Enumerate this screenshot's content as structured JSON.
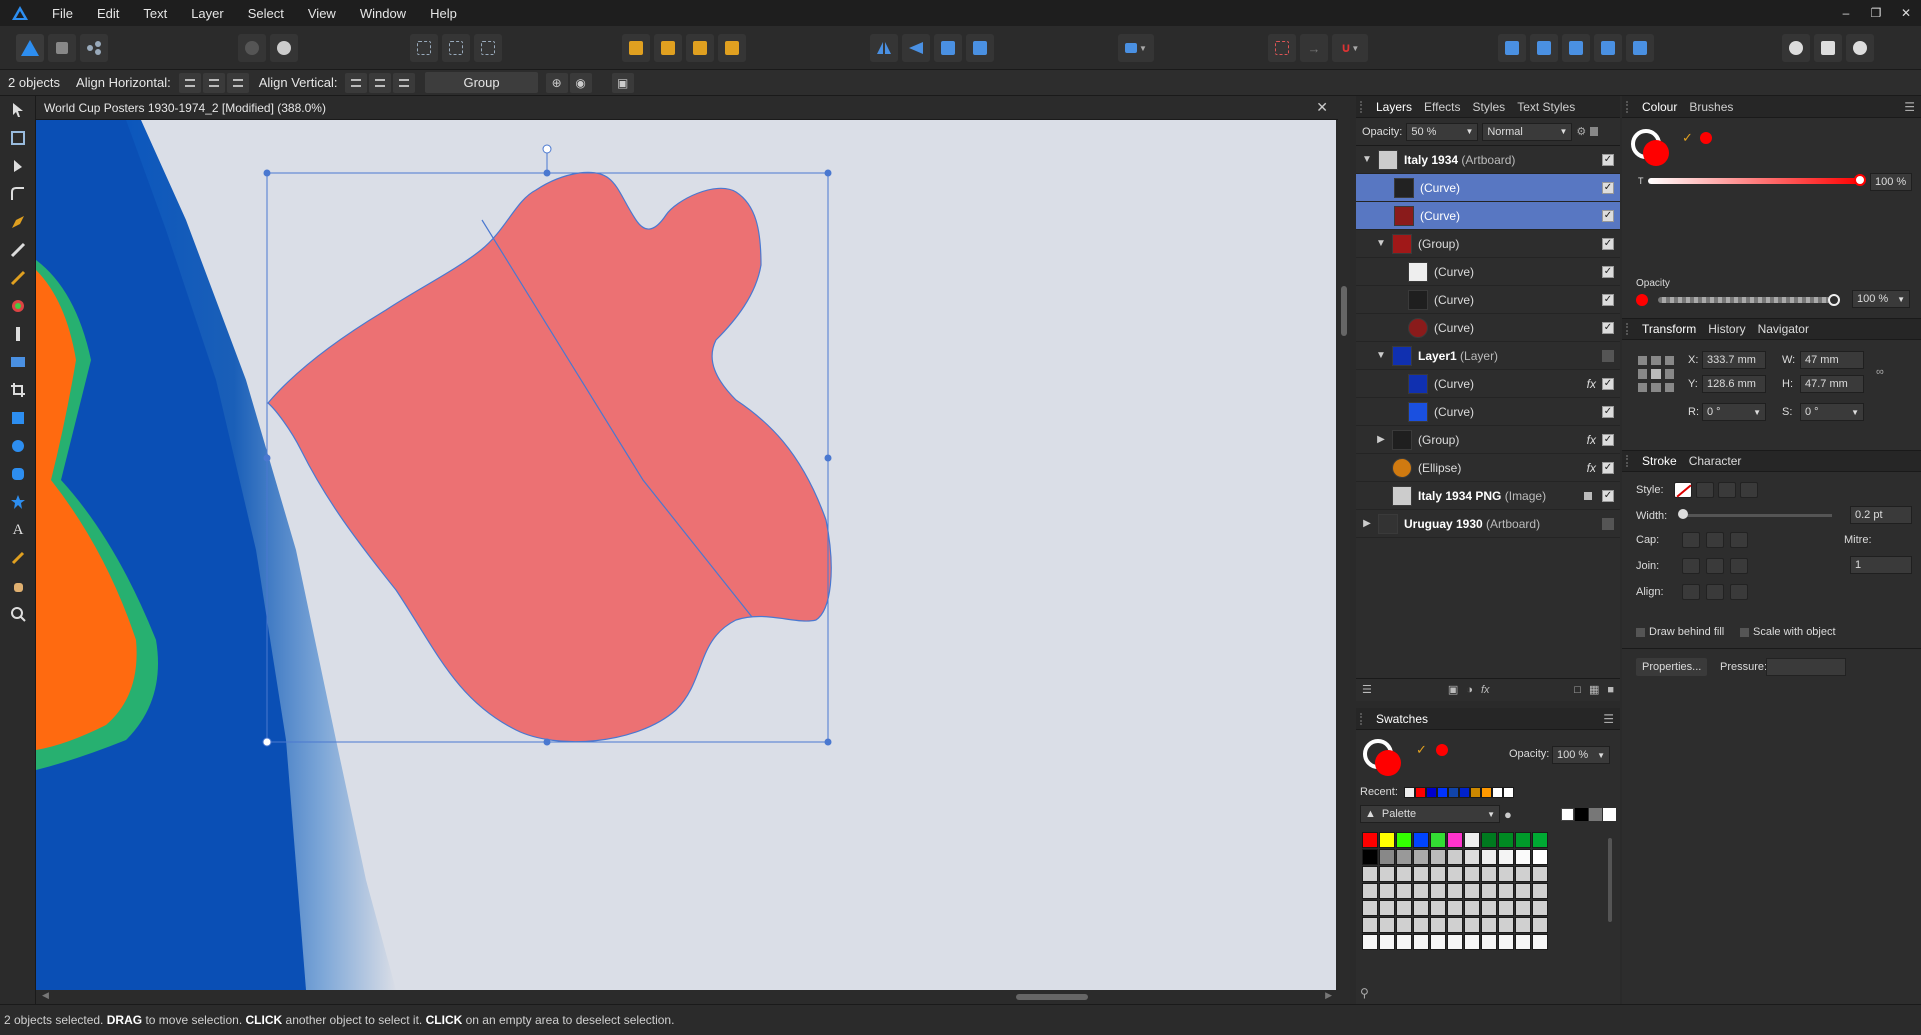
{
  "menubar": {
    "items": [
      "File",
      "Edit",
      "Text",
      "Layer",
      "Select",
      "View",
      "Window",
      "Help"
    ]
  },
  "context": {
    "selection_count": "2 objects",
    "align_horizontal": "Align Horizontal:",
    "align_vertical": "Align Vertical:",
    "group_button": "Group"
  },
  "document": {
    "title": "World Cup Posters 1930-1974_2 [Modified] (388.0%)"
  },
  "layers_panel": {
    "tabs": [
      "Layers",
      "Effects",
      "Styles",
      "Text Styles"
    ],
    "opacity_label": "Opacity:",
    "opacity_value": "50 %",
    "blend_mode": "Normal",
    "rows": [
      {
        "name": "Italy 1934",
        "kind": "(Artboard)",
        "bold": true
      },
      {
        "name": "",
        "kind": "(Curve)"
      },
      {
        "name": "",
        "kind": "(Curve)"
      },
      {
        "name": "",
        "kind": "(Group)"
      },
      {
        "name": "",
        "kind": "(Curve)"
      },
      {
        "name": "",
        "kind": "(Curve)"
      },
      {
        "name": "",
        "kind": "(Curve)"
      },
      {
        "name": "Layer1",
        "kind": "(Layer)",
        "bold": true
      },
      {
        "name": "",
        "kind": "(Curve)"
      },
      {
        "name": "",
        "kind": "(Curve)"
      },
      {
        "name": "",
        "kind": "(Group)"
      },
      {
        "name": "",
        "kind": "(Ellipse)"
      },
      {
        "name": "Italy 1934 PNG",
        "kind": "(Image)",
        "bold": true
      },
      {
        "name": "Uruguay 1930",
        "kind": "(Artboard)",
        "bold": true
      }
    ],
    "fx_label": "fx"
  },
  "swatches_panel": {
    "tab": "Swatches",
    "opacity_label": "Opacity:",
    "opacity_value": "100 %",
    "recent_label": "Recent:",
    "palette_name": "Palette",
    "recent_colors": [
      "#eeeeee",
      "#ff0000",
      "#0000cc",
      "#0033ff",
      "#1144aa",
      "#0022cc",
      "#cc8800",
      "#ff9900",
      "#ffffff",
      "#ffffff"
    ],
    "grid_colors": [
      "#ff0000",
      "#ffff00",
      "#33ff00",
      "#0044ff",
      "#33dd33",
      "#ff33cc",
      "#eeeeee",
      "#007a1f",
      "#008a22",
      "#009a2a",
      "#00aa33",
      "#000000",
      "#888888",
      "#999999",
      "#aaaaaa",
      "#bbbbbb",
      "#cccccc",
      "#dddddd",
      "#eeeeee",
      "#f4f4f4",
      "#fafafa",
      "#ffffff"
    ]
  },
  "colour_panel": {
    "tabs": [
      "Colour",
      "Brushes"
    ],
    "tint_label": "T",
    "tint_value": "100 %",
    "tint_fraction": 1.0,
    "opacity_label": "Opacity",
    "opacity_value": "100 %",
    "opacity_fraction": 1.0
  },
  "transform_panel": {
    "tabs": [
      "Transform",
      "History",
      "Navigator"
    ],
    "x_label": "X:",
    "x_value": "333.7 mm",
    "y_label": "Y:",
    "y_value": "128.6 mm",
    "w_label": "W:",
    "w_value": "47 mm",
    "h_label": "H:",
    "h_value": "47.7 mm",
    "r_label": "R:",
    "r_value": "0 °",
    "s_label": "S:",
    "s_value": "0 °"
  },
  "stroke_panel": {
    "tabs": [
      "Stroke",
      "Character"
    ],
    "style_label": "Style:",
    "width_label": "Width:",
    "width_value": "0.2 pt",
    "cap_label": "Cap:",
    "join_label": "Join:",
    "align_label": "Align:",
    "mitre_label": "Mitre:",
    "mitre_value": "1",
    "draw_behind_fill": "Draw behind fill",
    "scale_with_object": "Scale with object",
    "properties_button": "Properties...",
    "pressure_label": "Pressure:"
  },
  "status": {
    "prefix": "2 objects selected.",
    "drag": "DRAG",
    "t1": "to move selection.",
    "click1": "CLICK",
    "t2": "another object to select it.",
    "click2": "CLICK",
    "t3": "on an empty area to deselect selection."
  },
  "colors": {
    "accent": "#5877c2",
    "fill_red": "#ff0000",
    "shape_fill": "#ec7173",
    "selection_blue": "#4a78d0"
  }
}
